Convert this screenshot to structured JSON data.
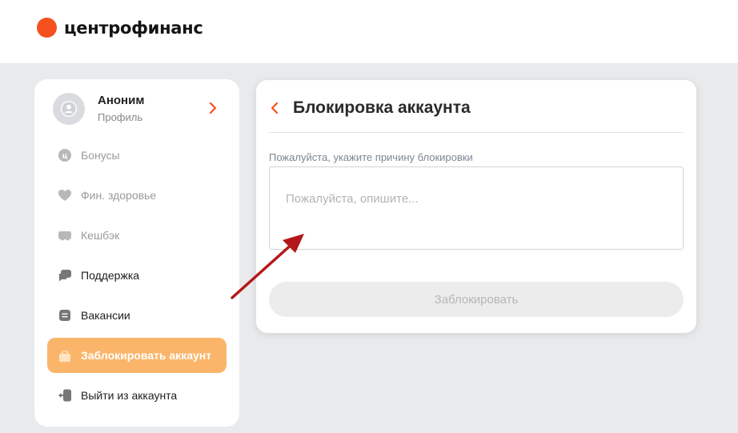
{
  "header": {
    "logo_text": "центрофинанс",
    "brand_color": "#f4511e"
  },
  "profile": {
    "name": "Аноним",
    "subtitle": "Профиль"
  },
  "menu": [
    {
      "label": "Бонусы",
      "icon": "bonus-icon",
      "state": "muted"
    },
    {
      "label": "Фин. здоровье",
      "icon": "heart-icon",
      "state": "muted"
    },
    {
      "label": "Кешбэк",
      "icon": "cashback-icon",
      "state": "muted"
    },
    {
      "label": "Поддержка",
      "icon": "chat-icon",
      "state": "normal"
    },
    {
      "label": "Вакансии",
      "icon": "briefcase-icon",
      "state": "normal"
    },
    {
      "label": "Заблокировать аккаунт",
      "icon": "lock-icon",
      "state": "active"
    },
    {
      "label": "Выйти из аккаунта",
      "icon": "logout-icon",
      "state": "normal"
    }
  ],
  "block_card": {
    "title": "Блокировка аккаунта",
    "field_label": "Пожалуйста, укажите причину блокировки",
    "placeholder": "Пожалуйста, опишите...",
    "submit_label": "Заблокировать"
  },
  "colors": {
    "accent": "#f4511e",
    "active_menu": "#fbb56a",
    "annotation_arrow": "#b41818"
  }
}
